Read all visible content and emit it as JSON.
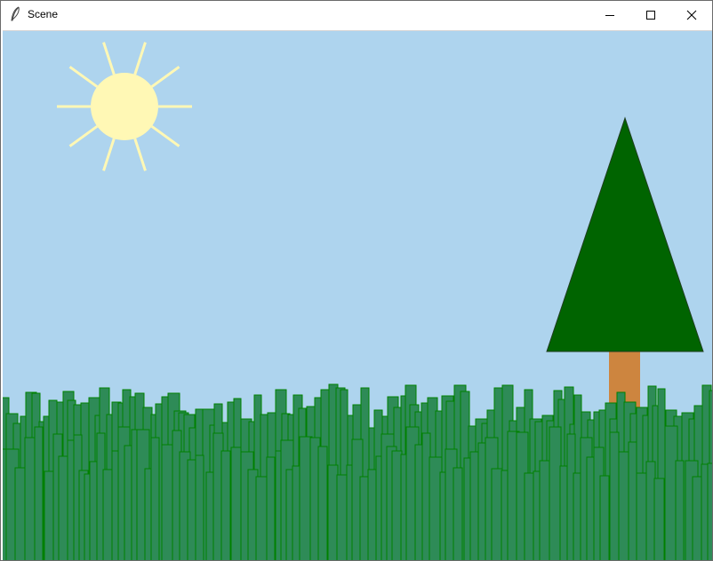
{
  "window": {
    "title": "Scene",
    "icons": {
      "app": "feather-icon",
      "minimize": "minimize-icon",
      "maximize": "maximize-icon",
      "close": "close-icon"
    }
  },
  "scene": {
    "colors": {
      "sky": "#aed4ee",
      "sun": "#fff8b5",
      "sun_rays": "#fff8b5",
      "tree_foliage": "#006400",
      "tree_trunk": "#cd853f",
      "fence": "#b22222",
      "grass_fill": "#2e8b57",
      "grass_outline": "#008000"
    }
  }
}
